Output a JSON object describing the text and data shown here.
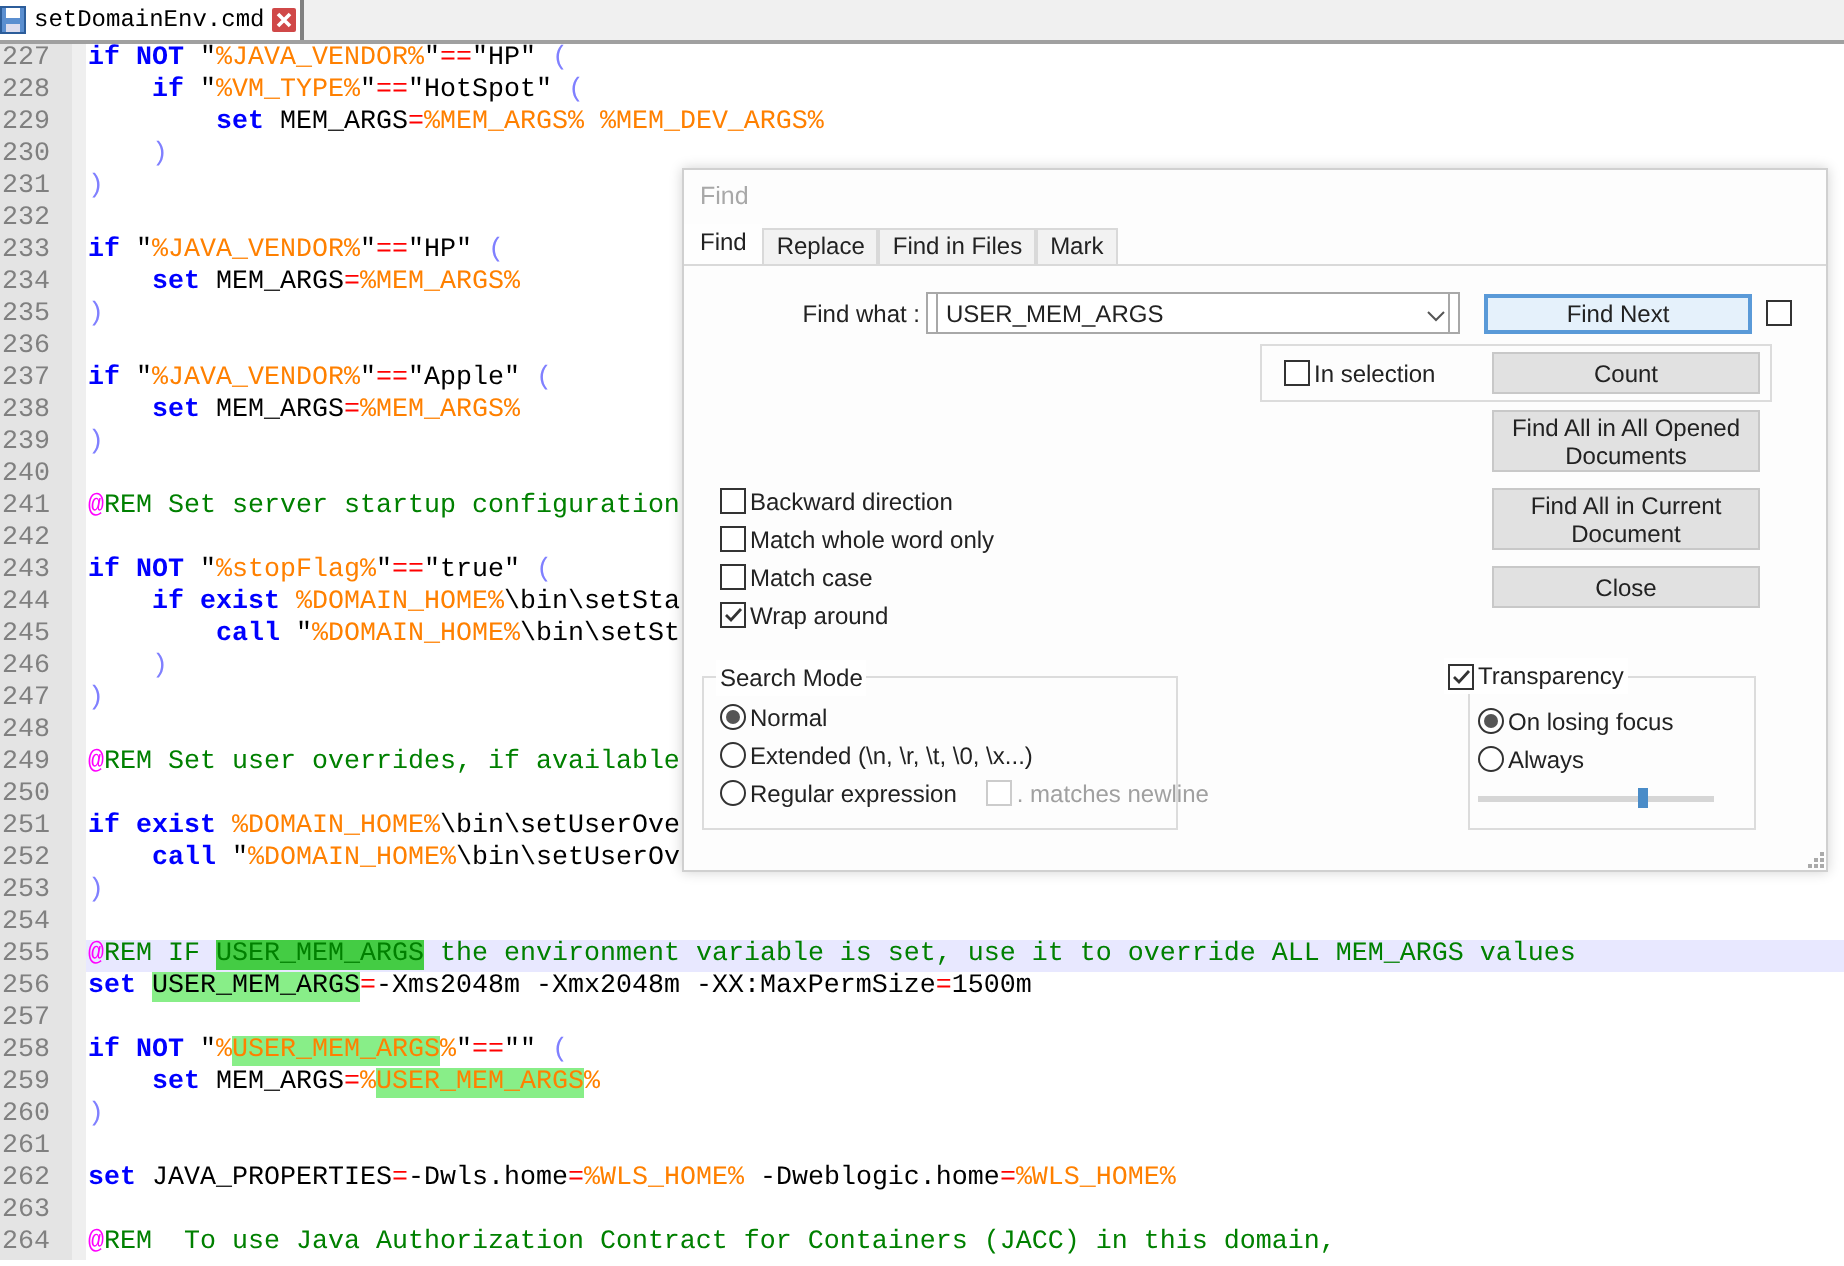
{
  "tab": {
    "title": "setDomainEnv.cmd",
    "selected": true
  },
  "editor": {
    "lines": [
      {
        "n": "227",
        "current": false,
        "tokens": [
          {
            "text": "if NOT",
            "kind": "kw"
          },
          {
            "text": " \"",
            "kind": "tx"
          },
          {
            "text": "%JAVA_VENDOR%",
            "kind": "var"
          },
          {
            "text": "\"",
            "kind": "tx"
          },
          {
            "text": "==",
            "kind": "op"
          },
          {
            "text": "\"HP\" ",
            "kind": "tx"
          },
          {
            "text": "(",
            "kind": "pr"
          }
        ]
      },
      {
        "n": "228",
        "current": false,
        "tokens": [
          {
            "text": "    if",
            "kind": "kw"
          },
          {
            "text": " \"",
            "kind": "tx"
          },
          {
            "text": "%VM_TYPE%",
            "kind": "var"
          },
          {
            "text": "\"",
            "kind": "tx"
          },
          {
            "text": "==",
            "kind": "op"
          },
          {
            "text": "\"HotSpot\" ",
            "kind": "tx"
          },
          {
            "text": "(",
            "kind": "pr"
          }
        ]
      },
      {
        "n": "229",
        "current": false,
        "tokens": [
          {
            "text": "        set",
            "kind": "kw"
          },
          {
            "text": " MEM_ARGS",
            "kind": "tx"
          },
          {
            "text": "=",
            "kind": "op"
          },
          {
            "text": "%MEM_ARGS%",
            "kind": "var"
          },
          {
            "text": " %MEM_DEV_ARGS%",
            "kind": "var"
          }
        ]
      },
      {
        "n": "230",
        "current": false,
        "tokens": [
          {
            "text": "    )",
            "kind": "pr"
          }
        ]
      },
      {
        "n": "231",
        "current": false,
        "tokens": [
          {
            "text": ")",
            "kind": "pr"
          }
        ]
      },
      {
        "n": "232",
        "current": false
      },
      {
        "n": "233",
        "current": false,
        "tokens": [
          {
            "text": "if",
            "kind": "kw"
          },
          {
            "text": " \"",
            "kind": "tx"
          },
          {
            "text": "%JAVA_VENDOR%",
            "kind": "var"
          },
          {
            "text": "\"",
            "kind": "tx"
          },
          {
            "text": "==",
            "kind": "op"
          },
          {
            "text": "\"HP\" ",
            "kind": "tx"
          },
          {
            "text": "(",
            "kind": "pr"
          }
        ]
      },
      {
        "n": "234",
        "current": false,
        "tokens": [
          {
            "text": "    set",
            "kind": "kw"
          },
          {
            "text": " MEM_ARGS",
            "kind": "tx"
          },
          {
            "text": "=",
            "kind": "op"
          },
          {
            "text": "%MEM_ARGS%",
            "kind": "var"
          }
        ]
      },
      {
        "n": "235",
        "current": false,
        "tokens": [
          {
            "text": ")",
            "kind": "pr"
          }
        ]
      },
      {
        "n": "236",
        "current": false
      },
      {
        "n": "237",
        "current": false,
        "tokens": [
          {
            "text": "if",
            "kind": "kw"
          },
          {
            "text": " \"",
            "kind": "tx"
          },
          {
            "text": "%JAVA_VENDOR%",
            "kind": "var"
          },
          {
            "text": "\"",
            "kind": "tx"
          },
          {
            "text": "==",
            "kind": "op"
          },
          {
            "text": "\"Apple\" ",
            "kind": "tx"
          },
          {
            "text": "(",
            "kind": "pr"
          }
        ]
      },
      {
        "n": "238",
        "current": false,
        "tokens": [
          {
            "text": "    set",
            "kind": "kw"
          },
          {
            "text": " MEM_ARGS",
            "kind": "tx"
          },
          {
            "text": "=",
            "kind": "op"
          },
          {
            "text": "%MEM_ARGS%",
            "kind": "var"
          }
        ]
      },
      {
        "n": "239",
        "current": false,
        "tokens": [
          {
            "text": ")",
            "kind": "pr"
          }
        ]
      },
      {
        "n": "240",
        "current": false
      },
      {
        "n": "241",
        "current": false,
        "tokens": [
          {
            "text": "@",
            "kind": "at"
          },
          {
            "text": "REM Set server startup configuration",
            "kind": "cm"
          }
        ]
      },
      {
        "n": "242",
        "current": false
      },
      {
        "n": "243",
        "current": false,
        "tokens": [
          {
            "text": "if NOT",
            "kind": "kw"
          },
          {
            "text": " \"",
            "kind": "tx"
          },
          {
            "text": "%stopFlag%",
            "kind": "var"
          },
          {
            "text": "\"",
            "kind": "tx"
          },
          {
            "text": "==",
            "kind": "op"
          },
          {
            "text": "\"true\" ",
            "kind": "tx"
          },
          {
            "text": "(",
            "kind": "pr"
          }
        ]
      },
      {
        "n": "244",
        "current": false,
        "tokens": [
          {
            "text": "    if exist",
            "kind": "kw"
          },
          {
            "text": " %DOMAIN_HOME%",
            "kind": "var"
          },
          {
            "text": "\\bin\\setSta",
            "kind": "tx"
          }
        ]
      },
      {
        "n": "245",
        "current": false,
        "tokens": [
          {
            "text": "        call",
            "kind": "kw"
          },
          {
            "text": " \"",
            "kind": "tx"
          },
          {
            "text": "%DOMAIN_HOME%",
            "kind": "var"
          },
          {
            "text": "\\bin\\setSt",
            "kind": "tx"
          }
        ]
      },
      {
        "n": "246",
        "current": false,
        "tokens": [
          {
            "text": "    )",
            "kind": "pr"
          }
        ]
      },
      {
        "n": "247",
        "current": false,
        "tokens": [
          {
            "text": ")",
            "kind": "pr"
          }
        ]
      },
      {
        "n": "248",
        "current": false
      },
      {
        "n": "249",
        "current": false,
        "tokens": [
          {
            "text": "@",
            "kind": "at"
          },
          {
            "text": "REM Set user overrides, if available",
            "kind": "cm"
          }
        ]
      },
      {
        "n": "250",
        "current": false
      },
      {
        "n": "251",
        "current": false,
        "tokens": [
          {
            "text": "if exist",
            "kind": "kw"
          },
          {
            "text": " %DOMAIN_HOME%",
            "kind": "var"
          },
          {
            "text": "\\bin\\setUserOve",
            "kind": "tx"
          }
        ]
      },
      {
        "n": "252",
        "current": false,
        "tokens": [
          {
            "text": "    call",
            "kind": "kw"
          },
          {
            "text": " \"",
            "kind": "tx"
          },
          {
            "text": "%DOMAIN_HOME%",
            "kind": "var"
          },
          {
            "text": "\\bin\\setUserOv",
            "kind": "tx"
          }
        ]
      },
      {
        "n": "253",
        "current": false,
        "tokens": [
          {
            "text": ")",
            "kind": "pr"
          }
        ]
      },
      {
        "n": "254",
        "current": false
      },
      {
        "n": "255",
        "current": true,
        "tokens": [
          {
            "text": "@",
            "kind": "at"
          },
          {
            "text": "REM IF ",
            "kind": "cm"
          },
          {
            "text": "USER_MEM_ARGS",
            "kind": "cm",
            "match": true,
            "active": true
          },
          {
            "text": " the environment variable is set, use it to override ALL MEM_ARGS values",
            "kind": "cm"
          }
        ]
      },
      {
        "n": "256",
        "current": false,
        "tokens": [
          {
            "text": "set ",
            "kind": "kw"
          },
          {
            "text": "USER_MEM_ARGS",
            "kind": "tx",
            "match": true,
            "active": false
          },
          {
            "text": "=",
            "kind": "op"
          },
          {
            "text": "-Xms2048m -Xmx2048m -XX:MaxPermSize",
            "kind": "tx"
          },
          {
            "text": "=",
            "kind": "op"
          },
          {
            "text": "1500m",
            "kind": "tx"
          }
        ]
      },
      {
        "n": "257",
        "current": false
      },
      {
        "n": "258",
        "current": false,
        "tokens": [
          {
            "text": "if NOT",
            "kind": "kw"
          },
          {
            "text": " \"",
            "kind": "tx"
          },
          {
            "text": "%",
            "kind": "var"
          },
          {
            "text": "USER_MEM_ARGS",
            "kind": "var",
            "match": true,
            "active": false
          },
          {
            "text": "%",
            "kind": "var"
          },
          {
            "text": "\"",
            "kind": "tx"
          },
          {
            "text": "==",
            "kind": "op"
          },
          {
            "text": "\"\" ",
            "kind": "tx"
          },
          {
            "text": "(",
            "kind": "pr"
          }
        ]
      },
      {
        "n": "259",
        "current": false,
        "tokens": [
          {
            "text": "    set",
            "kind": "kw"
          },
          {
            "text": " MEM_ARGS",
            "kind": "tx"
          },
          {
            "text": "=",
            "kind": "op"
          },
          {
            "text": "%",
            "kind": "var"
          },
          {
            "text": "USER_MEM_ARGS",
            "kind": "var",
            "match": true,
            "active": false
          },
          {
            "text": "%",
            "kind": "var"
          }
        ]
      },
      {
        "n": "260",
        "current": false,
        "tokens": [
          {
            "text": ")",
            "kind": "pr"
          }
        ]
      },
      {
        "n": "261",
        "current": false
      },
      {
        "n": "262",
        "current": false,
        "tokens": [
          {
            "text": "set",
            "kind": "kw"
          },
          {
            "text": " JAVA_PROPERTIES",
            "kind": "tx"
          },
          {
            "text": "=",
            "kind": "op"
          },
          {
            "text": "-Dwls.home",
            "kind": "tx"
          },
          {
            "text": "=",
            "kind": "op"
          },
          {
            "text": "%WLS_HOME%",
            "kind": "var"
          },
          {
            "text": " -Dweblogic.home",
            "kind": "tx"
          },
          {
            "text": "=",
            "kind": "op"
          },
          {
            "text": "%WLS_HOME%",
            "kind": "var"
          }
        ]
      },
      {
        "n": "263",
        "current": false
      },
      {
        "n": "264",
        "current": false,
        "tokens": [
          {
            "text": "@",
            "kind": "at"
          },
          {
            "text": "REM  To use Java Authorization Contract for Containers (JACC) in this domain,",
            "kind": "cm"
          }
        ]
      }
    ]
  },
  "find_dialog": {
    "title": "Find",
    "tabs": [
      {
        "label": "Find",
        "selected": true
      },
      {
        "label": "Replace",
        "selected": false
      },
      {
        "label": "Find in Files",
        "selected": false
      },
      {
        "label": "Mark",
        "selected": false
      }
    ],
    "find_what": {
      "label": "Find what :",
      "value": "USER_MEM_ARGS"
    },
    "find_next": {
      "label": "Find Next",
      "default": true
    },
    "side_checkbox": {
      "checked": false
    },
    "in_selection": {
      "label": "In selection",
      "checked": false
    },
    "count": "Count",
    "find_all_opened": "Find All in All Opened Documents",
    "find_all_current": "Find All in Current Document",
    "close": "Close",
    "options": [
      {
        "label": "Backward direction",
        "checked": false
      },
      {
        "label": "Match whole word only",
        "checked": false
      },
      {
        "label": "Match case",
        "checked": false
      },
      {
        "label": "Wrap around",
        "checked": true
      }
    ],
    "search_mode": {
      "title": "Search Mode",
      "modes": [
        {
          "label": "Normal",
          "selected": true
        },
        {
          "label": "Extended (\\n, \\r, \\t, \\0, \\x...)",
          "selected": false
        },
        {
          "label": "Regular expression",
          "selected": false
        }
      ],
      "dot_newline": {
        "label": ". matches newline",
        "checked": false,
        "disabled": true
      }
    },
    "transparency": {
      "label": "Transparency",
      "checked": true,
      "modes": [
        {
          "label": "On losing focus",
          "selected": true
        },
        {
          "label": "Always",
          "selected": false
        }
      ],
      "level": 0.71
    }
  }
}
